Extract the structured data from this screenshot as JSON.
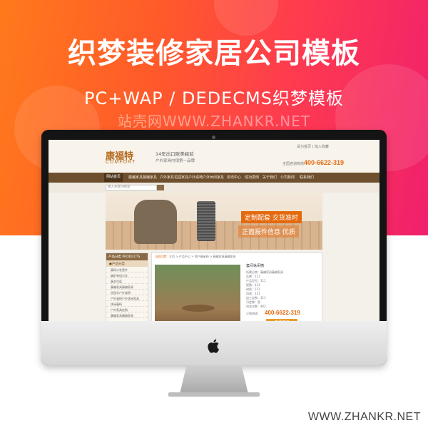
{
  "hero": {
    "title": "织梦装修家居公司模板",
    "subtitle": "PC+WAP / DEDECMS织梦模板",
    "watermark": "站壳网WWW.ZHANKR.NET"
  },
  "footer_url": "WWW.ZHANKR.NET",
  "site": {
    "logo_cn": "康福特",
    "logo_en": "COMFORT",
    "slogan_line1": "14年出口欧美经验",
    "slogan_line2": "户外家具内销第一品牌",
    "top_links": "设为首页 | 加入收藏",
    "hotline_label": "全国咨询热线：",
    "hotline": "400-6622-319",
    "nav": [
      "网站首页",
      "藤编家具藤编家具",
      "户外家具花园家具",
      "户外桌椅户外休闲家具",
      "资讯中心",
      "成功案例",
      "关于我们",
      "公司新闻",
      "联系我们"
    ],
    "search_placeholder": "输入关键词搜索",
    "banner_tag1": "定制配套 交货准时",
    "banner_tag2": "正面报件信息 优质",
    "sidebar": {
      "header": "产品分类 PRODUCTS",
      "subheader": "●产品分类",
      "items": [
        "藤椅沙发套件",
        "编织单组沙发",
        "藤艺吊篮",
        "藤编家具藤编家具",
        "花园伞户外桌椅",
        "户外桌椅户外休闲家具",
        "休闲藤椅",
        "户外家具定制",
        "藤编家具藤编家具"
      ]
    },
    "breadcrumb_label": "当前位置：",
    "breadcrumb": "主页 > 产品中心 > 地户藤桌椅 > 藤编家具藤编家具",
    "product": {
      "name": "套间休闲椅",
      "info": [
        "所属分类：藤编家具藤编家具",
        "品牌：111",
        "产品型号：111",
        "规格：111",
        "材质：111",
        "用途：111",
        "加工定制：111",
        "可定做：是",
        "浏览次数：402"
      ],
      "order_label": "订购热线：",
      "order_phone": "400-6622-319",
      "consult_button": "在线咨询"
    }
  },
  "colors": {
    "accent": "#e46a10",
    "nav": "#6e4f2d",
    "hero_start": "#ff7a1c",
    "hero_end": "#f0206d"
  }
}
